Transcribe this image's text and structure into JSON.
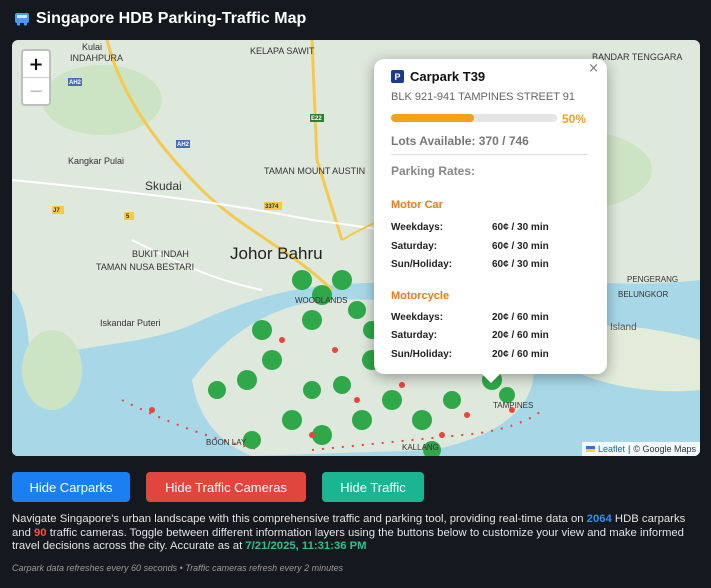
{
  "header": {
    "icon": "bus-icon",
    "title": "Singapore HDB Parking-Traffic Map"
  },
  "map": {
    "zoom_in": "+",
    "zoom_out": "−",
    "labels": {
      "kulai": "Kulai",
      "indahpura": "INDAHPURA",
      "kelapa_sawit": "KELAPA SAWIT",
      "bandar_tenggara": "BANDAR TENGGARA",
      "kangkar_pulai": "Kangkar Pulai",
      "taman_mount_austin": "TAMAN MOUNT AUSTIN",
      "skudai": "Skudai",
      "johor_bahru": "Johor Bahru",
      "bukit_indah": "BUKIT INDAH",
      "taman_nusa_bestari": "TAMAN NUSA BESTARI",
      "iskandar_puteri": "Iskandar Puteri",
      "woodlands": "WOODLANDS",
      "boon_lay": "BOON LAY",
      "kallang": "KALLANG",
      "tampines": "TAMPINES",
      "island": "Island",
      "pengerang": "PENGERANG",
      "belungkor": "BELUNGKOR",
      "ah2": "AH2",
      "e22": "E22",
      "e3": "E3",
      "r_5": "5",
      "r_50": "50",
      "r_94": "94",
      "r_3374": "3374",
      "r_j7": "J7",
      "r_j5": "J5",
      "r_3": "3"
    },
    "attribution": {
      "leaflet": "Leaflet",
      "google": "© Google Maps"
    }
  },
  "popup": {
    "close": "×",
    "badge": "P",
    "name": "Carpark T39",
    "address": "BLK 921-941 TAMPINES STREET 91",
    "occupancy_percent": 50,
    "percent_label": "50%",
    "lots_label": "Lots Available: 370 / 746",
    "rates_label": "Parking Rates:",
    "motor_car": {
      "title": "Motor Car",
      "rows": [
        {
          "day": "Weekdays:",
          "rate": "60¢ / 30 min"
        },
        {
          "day": "Saturday:",
          "rate": "60¢ / 30 min"
        },
        {
          "day": "Sun/Holiday:",
          "rate": "60¢ / 30 min"
        }
      ]
    },
    "motorcycle": {
      "title": "Motorcycle",
      "rows": [
        {
          "day": "Weekdays:",
          "rate": "20¢ / 60 min"
        },
        {
          "day": "Saturday:",
          "rate": "20¢ / 60 min"
        },
        {
          "day": "Sun/Holiday:",
          "rate": "20¢ / 60 min"
        }
      ]
    }
  },
  "buttons": {
    "carparks": "Hide Carparks",
    "cameras": "Hide Traffic Cameras",
    "traffic": "Hide Traffic"
  },
  "description": {
    "part1": "Navigate Singapore's urban landscape with this comprehensive traffic and parking tool, providing real-time data on ",
    "carpark_count": "2064",
    "part2": " HDB carparks and ",
    "camera_count": "90",
    "part3": " traffic cameras. Toggle between different information layers using the buttons below to customize your view and make informed travel decisions across the city. Accurate as at ",
    "timestamp": "7/21/2025, 11:31:36 PM"
  },
  "footer": "Carpark data refreshes every 60 seconds • Traffic cameras refresh every 2 minutes",
  "colors": {
    "blue_button": "#1a7ff0",
    "red_button": "#e0453e",
    "green_button": "#1bb592",
    "carpark_marker": "#2fa84a",
    "camera_marker": "#e8453c"
  }
}
